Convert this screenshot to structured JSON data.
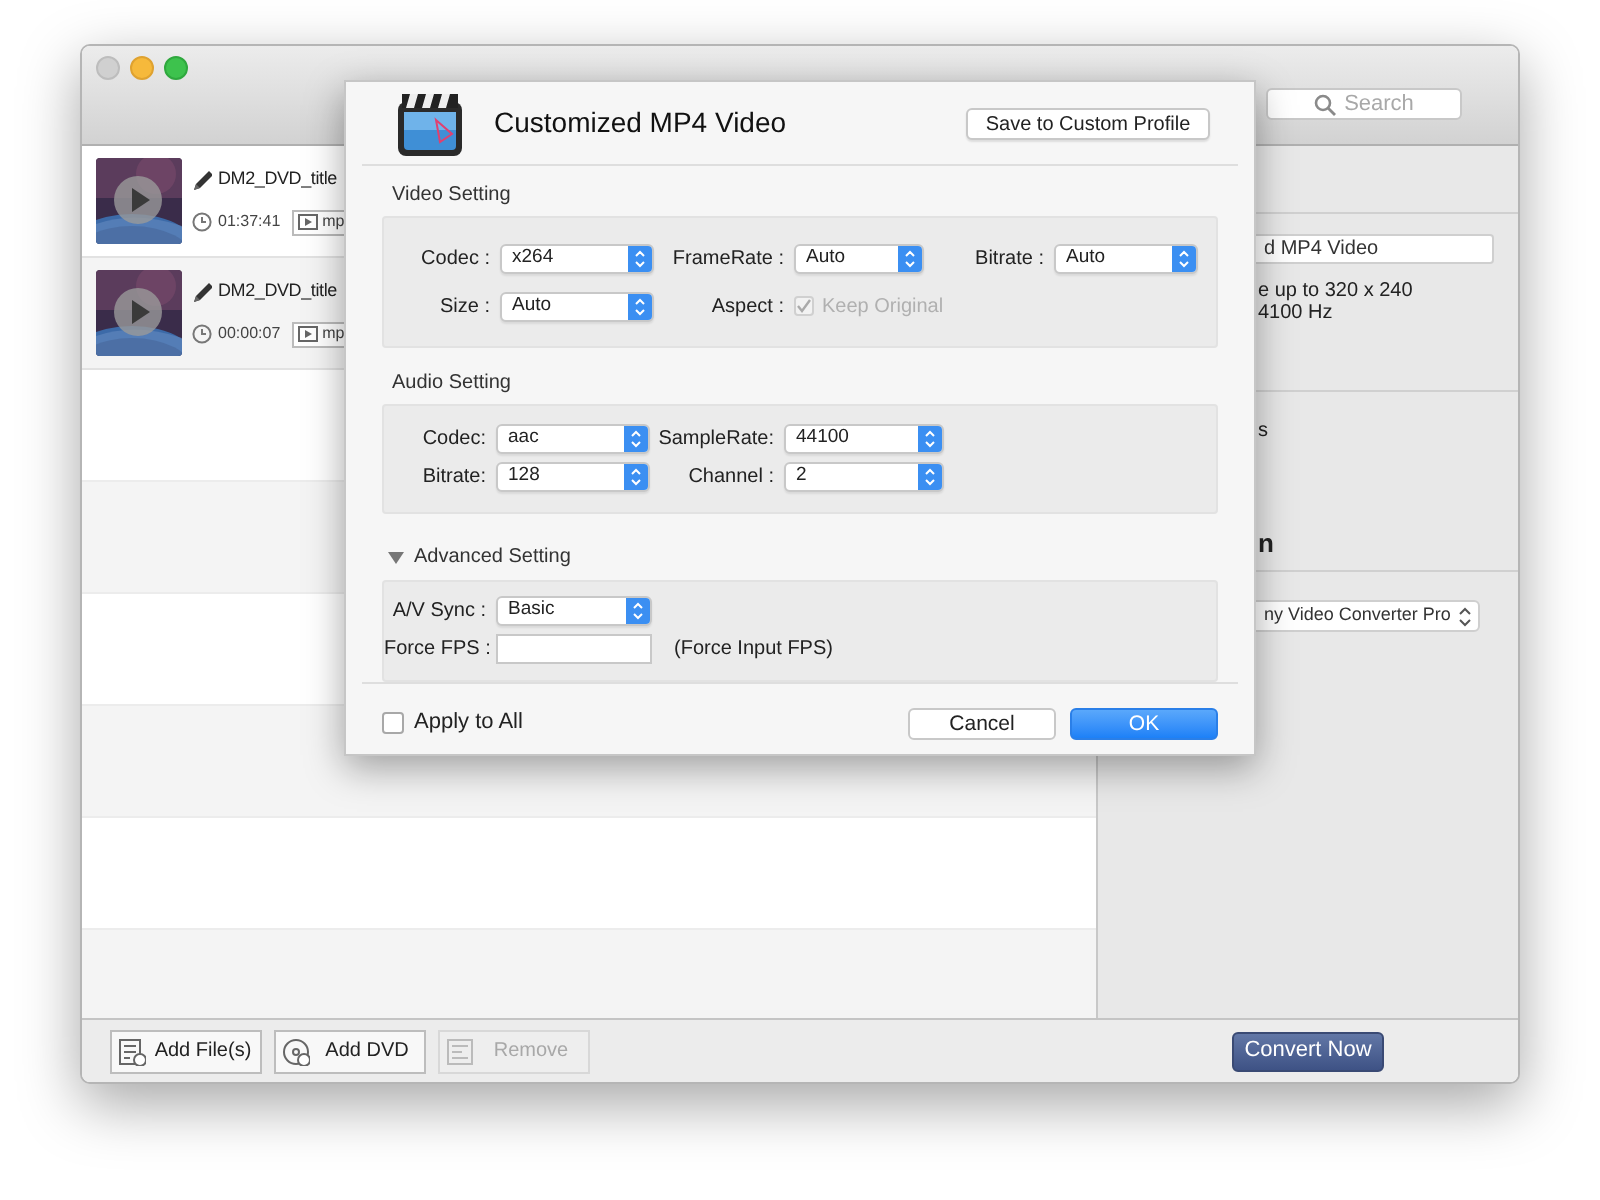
{
  "search": {
    "placeholder": "Search"
  },
  "files": [
    {
      "title": "DM2_DVD_title",
      "duration": "01:37:41",
      "format": "mp"
    },
    {
      "title": "DM2_DVD_title",
      "duration": "00:00:07",
      "format": "mp"
    }
  ],
  "side_panel": {
    "profile": "d MP4 Video",
    "info_lines": [
      "e up to 320 x 240",
      "4100 Hz"
    ],
    "section_text": "s",
    "section_heading": "n",
    "device": "ny Video Converter Pro"
  },
  "bottom_buttons": [
    {
      "kind": "files",
      "label": "Add File(s)",
      "disabled": false
    },
    {
      "kind": "dvd",
      "label": "Add DVD",
      "disabled": false
    },
    {
      "kind": "remove",
      "label": "Remove",
      "disabled": true
    }
  ],
  "convert_button": "Convert Now",
  "dialog": {
    "title": "Customized MP4 Video",
    "save_button": "Save to Custom Profile",
    "video": {
      "heading": "Video Setting",
      "rows": [
        [
          {
            "kind": "select",
            "label": "Codec :",
            "value": "x264"
          },
          {
            "kind": "select",
            "label": "FrameRate :",
            "value": "Auto"
          },
          {
            "kind": "select",
            "label": "Bitrate :",
            "value": "Auto"
          }
        ],
        [
          {
            "kind": "select",
            "label": "Size :",
            "value": "Auto"
          },
          {
            "kind": "checkbox",
            "label": "Aspect :",
            "value": "Keep Original",
            "checked": true,
            "disabled": true
          }
        ]
      ]
    },
    "audio": {
      "heading": "Audio Setting",
      "rows": [
        [
          {
            "kind": "select",
            "label": "Codec:",
            "value": "aac"
          },
          {
            "kind": "select",
            "label": "SampleRate:",
            "value": "44100"
          }
        ],
        [
          {
            "kind": "select",
            "label": "Bitrate:",
            "value": "128"
          },
          {
            "kind": "select",
            "label": "Channel :",
            "value": "2"
          }
        ]
      ]
    },
    "advanced": {
      "heading": "Advanced Setting",
      "expanded": true,
      "rows": [
        [
          {
            "kind": "select",
            "label": "A/V Sync :",
            "value": "Basic"
          }
        ],
        [
          {
            "kind": "input",
            "label": "Force FPS :",
            "hint": "(Force Input FPS)"
          }
        ]
      ]
    },
    "apply_to_all": {
      "label": "Apply to All",
      "checked": false
    },
    "buttons": [
      {
        "label": "Cancel",
        "default": false
      },
      {
        "label": "OK",
        "default": true
      }
    ]
  }
}
